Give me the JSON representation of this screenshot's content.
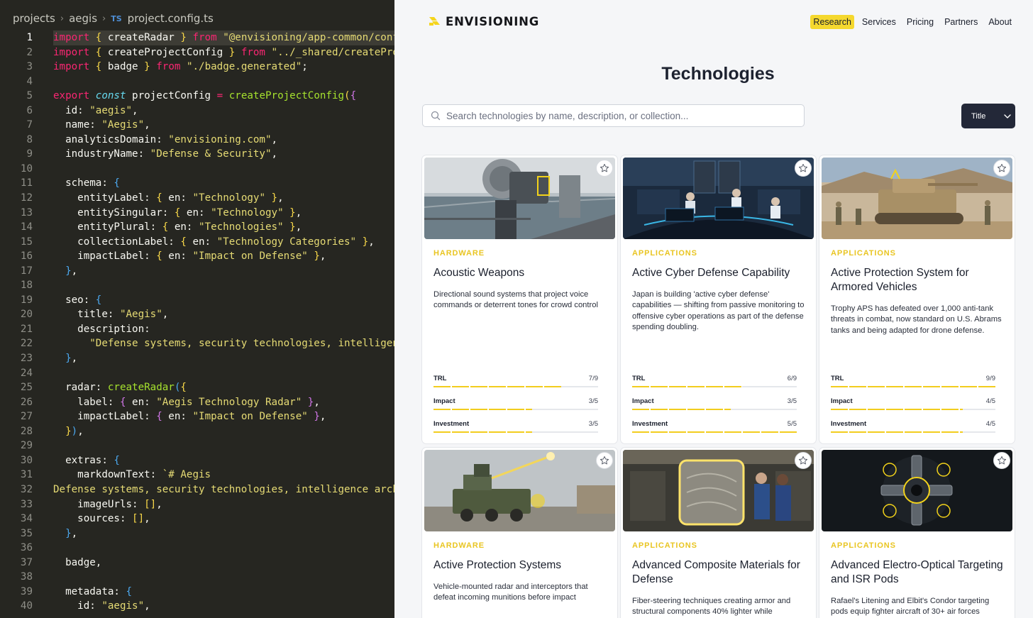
{
  "editor": {
    "breadcrumb": {
      "root": "projects",
      "folder": "aegis",
      "file_type_badge": "TS",
      "file": "project.config.ts"
    },
    "current_line": 1,
    "lines": [
      [
        [
          "kw",
          "import"
        ],
        [
          "pn",
          " "
        ],
        [
          "b1",
          "{"
        ],
        [
          "pn",
          " createRadar "
        ],
        [
          "b1",
          "}"
        ],
        [
          "pn",
          " "
        ],
        [
          "kw",
          "from"
        ],
        [
          "pn",
          " "
        ],
        [
          "st",
          "\"@envisioning/app-common/config\""
        ]
      ],
      [
        [
          "kw",
          "import"
        ],
        [
          "pn",
          " "
        ],
        [
          "b1",
          "{"
        ],
        [
          "pn",
          " createProjectConfig "
        ],
        [
          "b1",
          "}"
        ],
        [
          "pn",
          " "
        ],
        [
          "kw",
          "from"
        ],
        [
          "pn",
          " "
        ],
        [
          "st",
          "\"../_shared/createProjectConfig\""
        ]
      ],
      [
        [
          "kw",
          "import"
        ],
        [
          "pn",
          " "
        ],
        [
          "b1",
          "{"
        ],
        [
          "pn",
          " badge "
        ],
        [
          "b1",
          "}"
        ],
        [
          "pn",
          " "
        ],
        [
          "kw",
          "from"
        ],
        [
          "pn",
          " "
        ],
        [
          "st",
          "\"./badge.generated\""
        ],
        [
          "pn",
          ";"
        ]
      ],
      [],
      [
        [
          "kw",
          "export"
        ],
        [
          "pn",
          " "
        ],
        [
          "sg",
          "const"
        ],
        [
          "pn",
          " projectConfig "
        ],
        [
          "op",
          "="
        ],
        [
          "pn",
          " "
        ],
        [
          "fn",
          "createProjectConfig"
        ],
        [
          "b1",
          "("
        ],
        [
          "b2",
          "{"
        ]
      ],
      [
        [
          "pn",
          "  id: "
        ],
        [
          "st",
          "\"aegis\""
        ],
        [
          "pn",
          ","
        ]
      ],
      [
        [
          "pn",
          "  name: "
        ],
        [
          "st",
          "\"Aegis\""
        ],
        [
          "pn",
          ","
        ]
      ],
      [
        [
          "pn",
          "  analyticsDomain: "
        ],
        [
          "st",
          "\"envisioning.com\""
        ],
        [
          "pn",
          ","
        ]
      ],
      [
        [
          "pn",
          "  industryName: "
        ],
        [
          "st",
          "\"Defense & Security\""
        ],
        [
          "pn",
          ","
        ]
      ],
      [],
      [
        [
          "pn",
          "  schema: "
        ],
        [
          "b3",
          "{"
        ]
      ],
      [
        [
          "pn",
          "    entityLabel: "
        ],
        [
          "b1",
          "{"
        ],
        [
          "pn",
          " en: "
        ],
        [
          "st",
          "\"Technology\""
        ],
        [
          "pn",
          " "
        ],
        [
          "b1",
          "}"
        ],
        [
          "pn",
          ","
        ]
      ],
      [
        [
          "pn",
          "    entitySingular: "
        ],
        [
          "b1",
          "{"
        ],
        [
          "pn",
          " en: "
        ],
        [
          "st",
          "\"Technology\""
        ],
        [
          "pn",
          " "
        ],
        [
          "b1",
          "}"
        ],
        [
          "pn",
          ","
        ]
      ],
      [
        [
          "pn",
          "    entityPlural: "
        ],
        [
          "b1",
          "{"
        ],
        [
          "pn",
          " en: "
        ],
        [
          "st",
          "\"Technologies\""
        ],
        [
          "pn",
          " "
        ],
        [
          "b1",
          "}"
        ],
        [
          "pn",
          ","
        ]
      ],
      [
        [
          "pn",
          "    collectionLabel: "
        ],
        [
          "b1",
          "{"
        ],
        [
          "pn",
          " en: "
        ],
        [
          "st",
          "\"Technology Categories\""
        ],
        [
          "pn",
          " "
        ],
        [
          "b1",
          "}"
        ],
        [
          "pn",
          ","
        ]
      ],
      [
        [
          "pn",
          "    impactLabel: "
        ],
        [
          "b1",
          "{"
        ],
        [
          "pn",
          " en: "
        ],
        [
          "st",
          "\"Impact on Defense\""
        ],
        [
          "pn",
          " "
        ],
        [
          "b1",
          "}"
        ],
        [
          "pn",
          ","
        ]
      ],
      [
        [
          "pn",
          "  "
        ],
        [
          "b3",
          "}"
        ],
        [
          "pn",
          ","
        ]
      ],
      [],
      [
        [
          "pn",
          "  seo: "
        ],
        [
          "b3",
          "{"
        ]
      ],
      [
        [
          "pn",
          "    title: "
        ],
        [
          "st",
          "\"Aegis\""
        ],
        [
          "pn",
          ","
        ]
      ],
      [
        [
          "pn",
          "    description:"
        ]
      ],
      [
        [
          "pn",
          "      "
        ],
        [
          "st",
          "\"Defense systems, security technologies, intelligence architecture\""
        ]
      ],
      [
        [
          "pn",
          "  "
        ],
        [
          "b3",
          "}"
        ],
        [
          "pn",
          ","
        ]
      ],
      [],
      [
        [
          "pn",
          "  radar: "
        ],
        [
          "fn",
          "createRadar"
        ],
        [
          "b3",
          "("
        ],
        [
          "b1",
          "{"
        ]
      ],
      [
        [
          "pn",
          "    label: "
        ],
        [
          "b2",
          "{"
        ],
        [
          "pn",
          " en: "
        ],
        [
          "st",
          "\"Aegis Technology Radar\""
        ],
        [
          "pn",
          " "
        ],
        [
          "b2",
          "}"
        ],
        [
          "pn",
          ","
        ]
      ],
      [
        [
          "pn",
          "    impactLabel: "
        ],
        [
          "b2",
          "{"
        ],
        [
          "pn",
          " en: "
        ],
        [
          "st",
          "\"Impact on Defense\""
        ],
        [
          "pn",
          " "
        ],
        [
          "b2",
          "}"
        ],
        [
          "pn",
          ","
        ]
      ],
      [
        [
          "pn",
          "  "
        ],
        [
          "b1",
          "}"
        ],
        [
          "b3",
          ")"
        ],
        [
          "pn",
          ","
        ]
      ],
      [],
      [
        [
          "pn",
          "  extras: "
        ],
        [
          "b3",
          "{"
        ]
      ],
      [
        [
          "pn",
          "    markdownText: "
        ],
        [
          "st",
          "`# Aegis"
        ]
      ],
      [
        [
          "st",
          "Defense systems, security technologies, intelligence architecture"
        ]
      ],
      [
        [
          "pn",
          "    imageUrls: "
        ],
        [
          "b1",
          "[]"
        ],
        [
          "pn",
          ","
        ]
      ],
      [
        [
          "pn",
          "    sources: "
        ],
        [
          "b1",
          "[]"
        ],
        [
          "pn",
          ","
        ]
      ],
      [
        [
          "pn",
          "  "
        ],
        [
          "b3",
          "}"
        ],
        [
          "pn",
          ","
        ]
      ],
      [],
      [
        [
          "pn",
          "  badge,"
        ]
      ],
      [],
      [
        [
          "pn",
          "  metadata: "
        ],
        [
          "b3",
          "{"
        ]
      ],
      [
        [
          "pn",
          "    id: "
        ],
        [
          "st",
          "\"aegis\""
        ],
        [
          "pn",
          ","
        ]
      ]
    ]
  },
  "site": {
    "logo_text": "ENVISIONING",
    "nav": [
      "Research",
      "Services",
      "Pricing",
      "Partners",
      "About"
    ],
    "active_nav": "Research",
    "title": "Technologies",
    "search_placeholder": "Search technologies by name, description, or collection...",
    "sort_label": "Title",
    "metric_labels": [
      "TRL",
      "Impact",
      "Investment"
    ],
    "accent_color": "#f2cd1e",
    "cards": [
      {
        "category": "HARDWARE",
        "title": "Acoustic Weapons",
        "description": "Directional sound systems that project voice commands or deterrent tones for crowd control",
        "trl": "7/9",
        "impact": "3/5",
        "investment": "3/5",
        "trl_fraction": 0.778,
        "impact_fraction": 0.6,
        "investment_fraction": 0.6,
        "image_icon": "naval-acoustic-device-image"
      },
      {
        "category": "APPLICATIONS",
        "title": "Active Cyber Defense Capability",
        "description": "Japan is building 'active cyber defense' capabilities — shifting from passive monitoring to offensive cyber operations as part of the defense spending doubling.",
        "trl": "6/9",
        "impact": "3/5",
        "investment": "5/5",
        "trl_fraction": 0.667,
        "impact_fraction": 0.6,
        "investment_fraction": 1.0,
        "image_icon": "cyber-operations-center-image"
      },
      {
        "category": "APPLICATIONS",
        "title": "Active Protection System for Armored Vehicles",
        "description": "Trophy APS has defeated over 1,000 anti-tank threats in combat, now standard on U.S. Abrams tanks and being adapted for drone defense.",
        "trl": "9/9",
        "impact": "4/5",
        "investment": "4/5",
        "trl_fraction": 1.0,
        "impact_fraction": 0.8,
        "investment_fraction": 0.8,
        "image_icon": "tank-image"
      },
      {
        "category": "HARDWARE",
        "title": "Active Protection Systems",
        "description": "Vehicle-mounted radar and interceptors that defeat incoming munitions before impact",
        "image_icon": "radar-truck-image"
      },
      {
        "category": "APPLICATIONS",
        "title": "Advanced Composite Materials for Defense",
        "description": "Fiber-steering techniques creating armor and structural components 40% lighter while",
        "image_icon": "composite-lab-image"
      },
      {
        "category": "APPLICATIONS",
        "title": "Advanced Electro-Optical Targeting and ISR Pods",
        "description": "Rafael's Litening and Elbit's Condor targeting pods equip fighter aircraft of 30+ air forces",
        "image_icon": "targeting-pod-image"
      }
    ]
  }
}
